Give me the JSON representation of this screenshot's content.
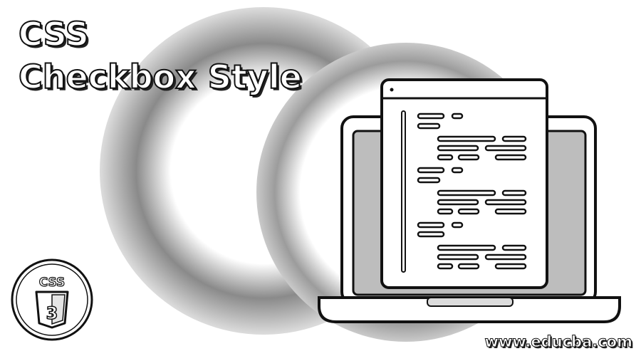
{
  "banner": {
    "title_line1": "CSS",
    "title_line2": "Checkbox Style",
    "url": "www.educba.com",
    "badge_label": "CSS",
    "badge_number": "3"
  },
  "illustration": {
    "icon": "laptop-code-icon"
  }
}
